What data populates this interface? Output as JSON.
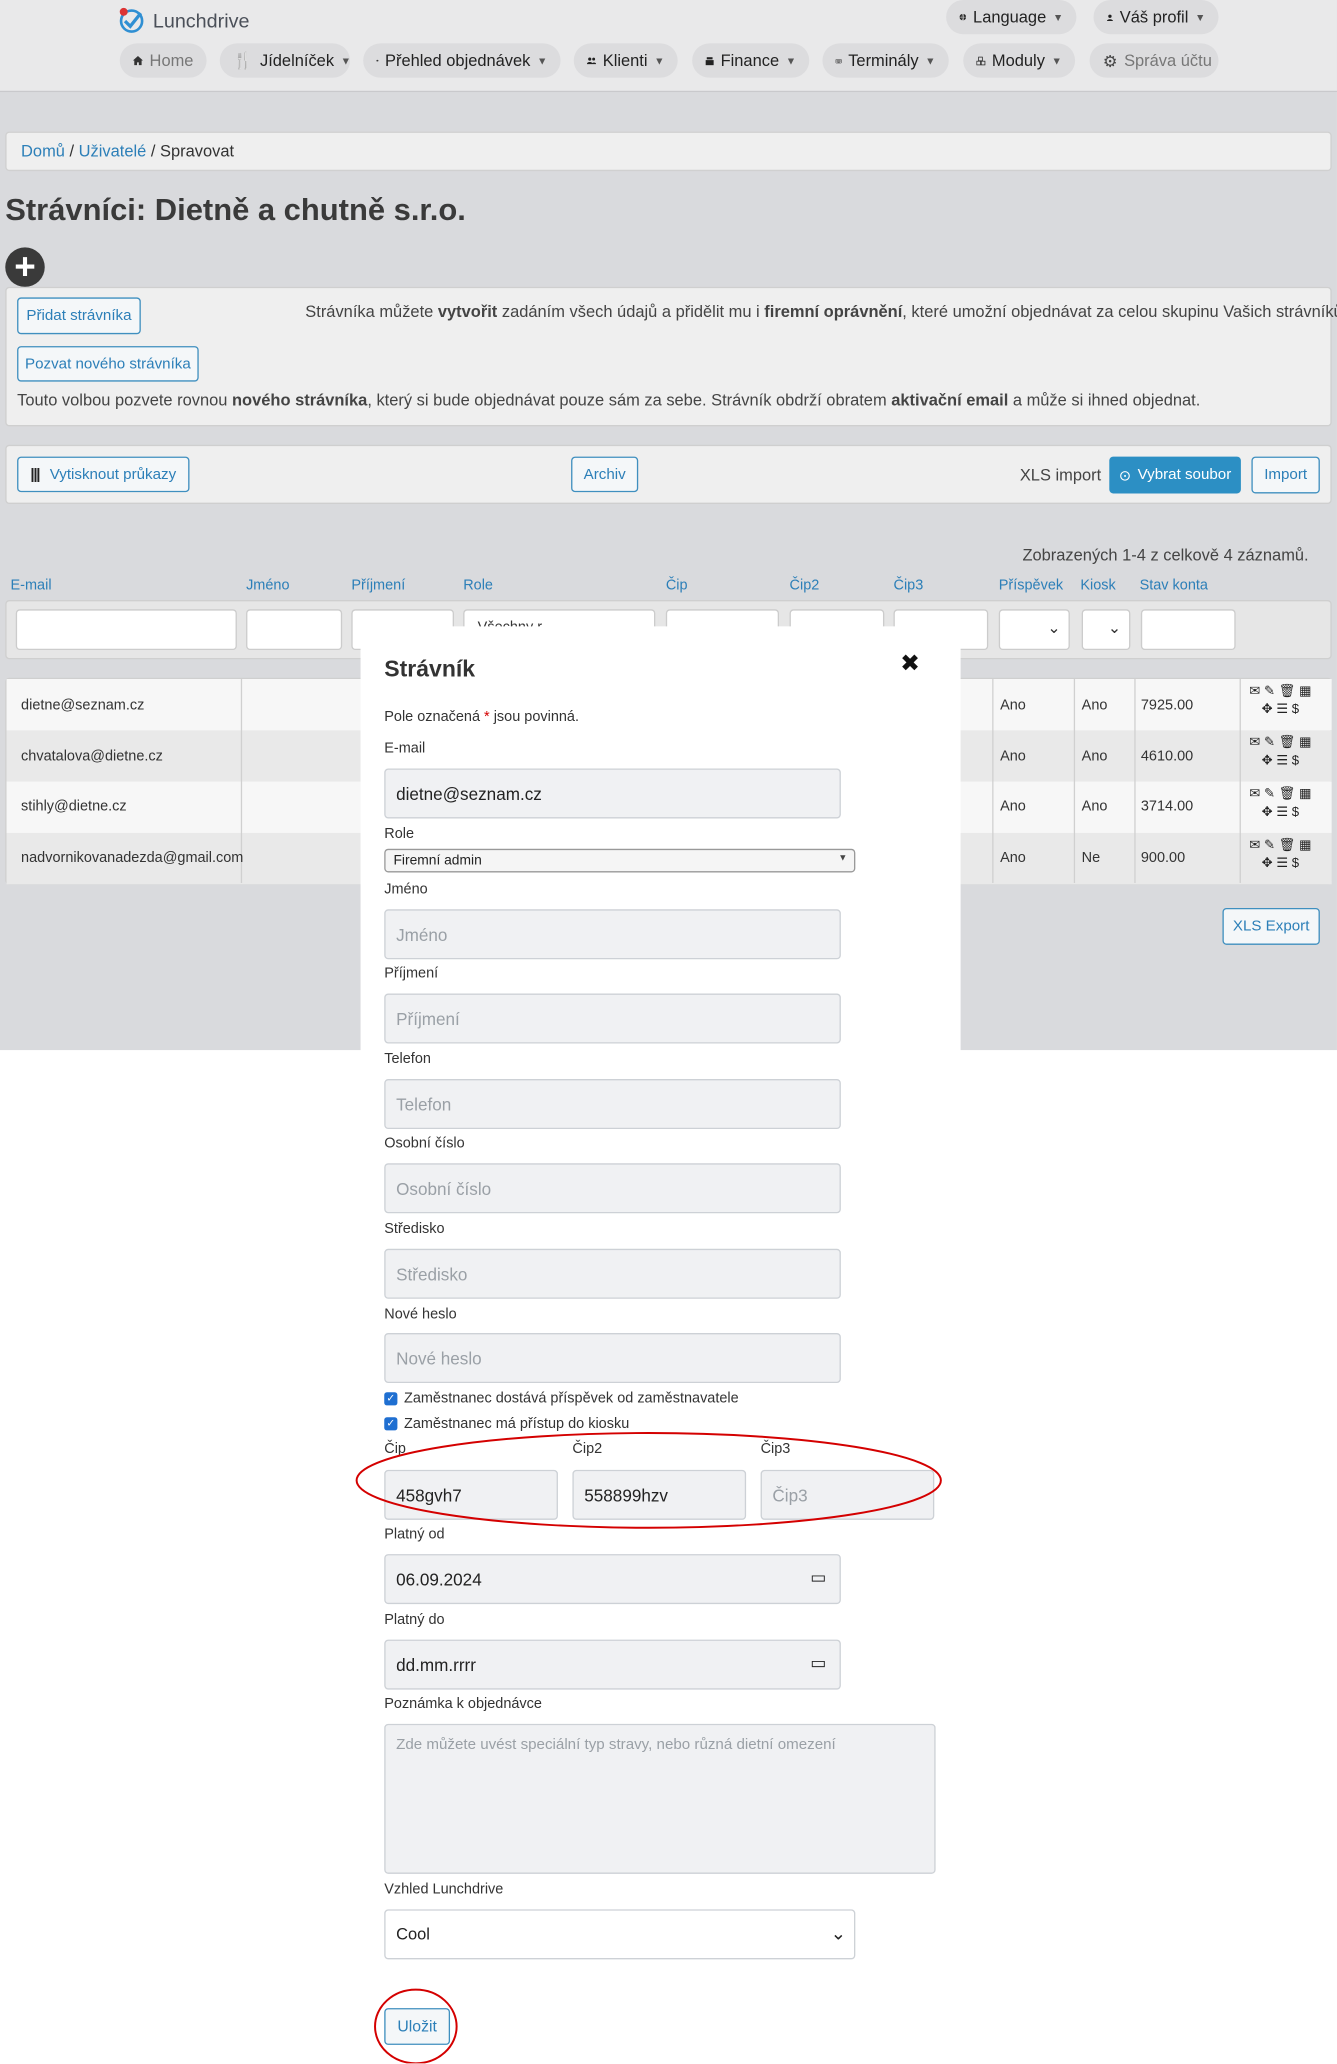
{
  "header": {
    "logo_text": "Lunchdrive",
    "language": "Language",
    "profile": "Váš profil",
    "nav": [
      "Home",
      "Jídelníček",
      "Přehled objednávek",
      "Klienti",
      "Finance",
      "Terminály",
      "Moduly",
      "Správa účtu"
    ]
  },
  "breadcrumb": {
    "home": "Domů",
    "users": "Uživatelé",
    "current": "Spravovat"
  },
  "page": {
    "title": "Strávníci: Dietně a chutně s.r.o."
  },
  "info": {
    "add_button": "Přidat strávníka",
    "add_text_1": "Strávníka můžete ",
    "add_text_b1": "vytvořit",
    "add_text_2": " zadáním všech údajů a přidělit mu i ",
    "add_text_b2": "firemní oprávnění",
    "add_text_3": ", které umožní objednávat za celou skupinu Vašich strávníků.",
    "invite_button": "Pozvat nového strávníka",
    "invite_text_1": "Touto volbou pozvete rovnou ",
    "invite_text_b1": "nového strávníka",
    "invite_text_2": ", který si bude objednávat pouze sám za sebe. Strávník obdrží obratem ",
    "invite_text_b2": "aktivační email",
    "invite_text_3": " a může si ihned objednat."
  },
  "toolbar": {
    "print_cards": "Vytisknout průkazy",
    "archive": "Archiv",
    "xls_import": "XLS import",
    "choose_file": "Vybrat soubor",
    "import": "Import"
  },
  "table": {
    "summary": "Zobrazených 1-4 z celkově 4 záznamů.",
    "columns": [
      "E-mail",
      "Jméno",
      "Příjmení",
      "Role",
      "Čip",
      "Čip2",
      "Čip3",
      "Příspěvek",
      "Kiosk",
      "Stav konta"
    ],
    "filter_role_partial": "Všechny r...",
    "rows": [
      {
        "email": "dietne@seznam.cz",
        "prispevek": "Ano",
        "kiosk": "Ano",
        "stav": "7925.00"
      },
      {
        "email": "chvatalova@dietne.cz",
        "prispevek": "Ano",
        "kiosk": "Ano",
        "stav": "4610.00"
      },
      {
        "email": "stihly@dietne.cz",
        "prispevek": "Ano",
        "kiosk": "Ano",
        "stav": "3714.00"
      },
      {
        "email": "nadvornikovanadezda@gmail.com",
        "prispevek": "Ano",
        "kiosk": "Ne",
        "stav": "900.00"
      }
    ],
    "xls_export": "XLS Export"
  },
  "modal": {
    "title": "Strávník",
    "required_note_1": "Pole označená ",
    "required_star": "*",
    "required_note_2": " jsou povinná.",
    "email_label": "E-mail",
    "email_value": "dietne@seznam.cz",
    "role_label": "Role",
    "role_value": "Firemní admin",
    "first_name_label": "Jméno",
    "first_name_placeholder": "Jméno",
    "last_name_label": "Příjmení",
    "last_name_placeholder": "Příjmení",
    "phone_label": "Telefon",
    "phone_placeholder": "Telefon",
    "personal_no_label": "Osobní číslo",
    "personal_no_placeholder": "Osobní číslo",
    "center_label": "Středisko",
    "center_placeholder": "Středisko",
    "password_label": "Nové heslo",
    "password_placeholder": "Nové heslo",
    "check_allowance": "Zaměstnanec dostává příspěvek od zaměstnavatele",
    "check_kiosk": "Zaměstnanec má přístup do kiosku",
    "chip_label": "Čip",
    "chip_value": "458gvh7",
    "chip2_label": "Čip2",
    "chip2_value": "558899hzv",
    "chip3_label": "Čip3",
    "chip3_placeholder": "Čip3",
    "valid_from_label": "Platný od",
    "valid_from_value": "06.09.2024",
    "valid_to_label": "Platný do",
    "valid_to_value": "dd.mm.rrrr",
    "note_label": "Poznámka k objednávce",
    "note_placeholder": "Zde můžete uvést speciální typ stravy, nebo různá dietní omezení",
    "theme_label": "Vzhled Lunchdrive",
    "theme_value": "Cool",
    "save": "Uložit"
  },
  "colors": {
    "accent": "#2c8fc4",
    "annotation": "#d40000"
  }
}
